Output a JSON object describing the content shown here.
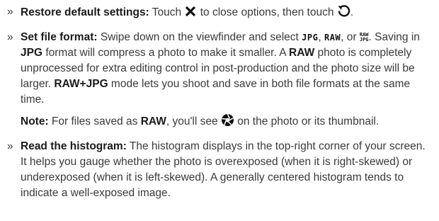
{
  "items": [
    {
      "bullet": "»",
      "title": "Restore default settings:",
      "t1": " Touch ",
      "icon1": "close-x-icon",
      "t2": " to close options, then touch ",
      "icon2": "reset-arrow-icon",
      "t3": "."
    },
    {
      "bullet": "»",
      "title": "Set file format:",
      "t1": " Swipe down on the viewfinder and select ",
      "fmt_jpg": "JPG",
      "t2": ", ",
      "fmt_raw": "RAW",
      "t3": ", or ",
      "fmt_rawjpg_top": "RAW",
      "fmt_rawjpg_bottom": "JPG",
      "t4": ". Saving in ",
      "b1": "JPG",
      "t5": " format will compress a photo to make it smaller. A ",
      "b2": "RAW",
      "t6": " photo is completely unprocessed for extra editing control in post-production and the photo size will be larger. ",
      "b3": "RAW+JPG",
      "t7": " mode lets you shoot and save in both file formats at the same time.",
      "note_label": "Note:",
      "note_t1": " For files saved as ",
      "note_b1": "RAW",
      "note_t2": ", you'll see ",
      "note_icon": "aperture-icon",
      "note_t3": " on the photo or its thumbnail."
    },
    {
      "bullet": "»",
      "title": "Read the histogram:",
      "t1": " The histogram displays in the top-right corner of your screen. It helps you gauge whether the photo is overexposed (when it is right-skewed) or underexposed (when it is left-skewed). A generally centered histogram tends to indicate a well-exposed image."
    }
  ]
}
